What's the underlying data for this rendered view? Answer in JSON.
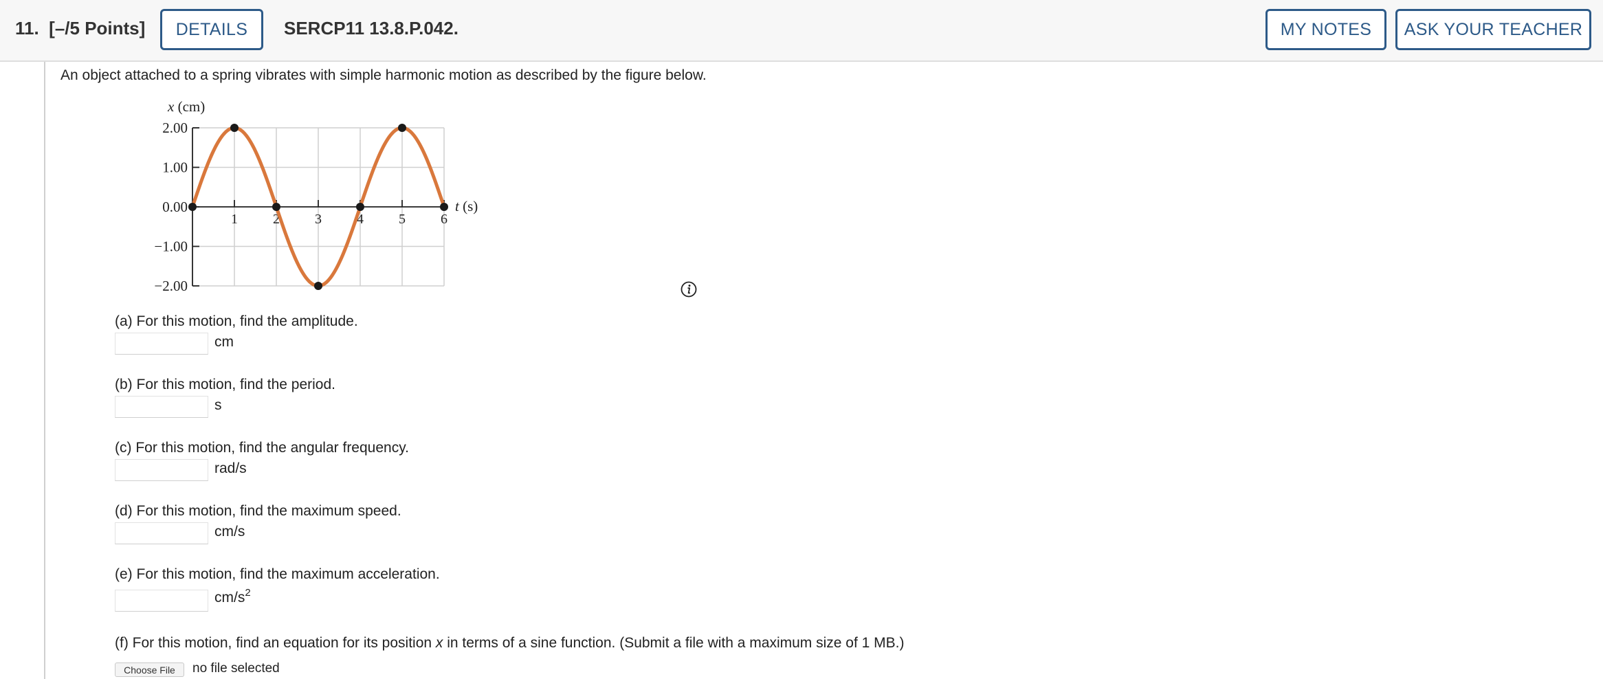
{
  "header": {
    "question_number": "11.",
    "points": "[–/5 Points]",
    "details_label": "DETAILS",
    "problem_code": "SERCP11 13.8.P.042.",
    "my_notes_label": "MY NOTES",
    "ask_teacher_label": "ASK YOUR TEACHER"
  },
  "intro": "An object attached to a spring vibrates with simple harmonic motion as described by the figure below.",
  "figure": {
    "y_axis_label": "x (cm)",
    "x_axis_label": "t (s)",
    "y_ticks": [
      "2.00",
      "1.00",
      "0.00",
      "−1.00",
      "−2.00"
    ],
    "x_ticks": [
      "1",
      "2",
      "3",
      "4",
      "5",
      "6"
    ],
    "curve_color": "#d9783c"
  },
  "chart_data": {
    "type": "line",
    "xlabel": "t (s)",
    "ylabel": "x (cm)",
    "xlim": [
      0,
      6
    ],
    "ylim": [
      -2,
      2
    ],
    "grid": true,
    "series": [
      {
        "x": [
          0,
          1,
          2,
          3,
          4,
          5,
          6
        ],
        "values": [
          0.0,
          2.0,
          0.0,
          -2.0,
          0.0,
          2.0,
          0.0
        ]
      }
    ],
    "marked_points": [
      [
        0,
        0
      ],
      [
        1,
        2
      ],
      [
        2,
        0
      ],
      [
        3,
        -2
      ],
      [
        4,
        0
      ],
      [
        5,
        2
      ],
      [
        6,
        0
      ]
    ]
  },
  "info_icon": "info-icon",
  "parts": {
    "a": {
      "question": "(a) For this motion, find the amplitude.",
      "unit": "cm"
    },
    "b": {
      "question": "(b) For this motion, find the period.",
      "unit": "s"
    },
    "c": {
      "question": "(c) For this motion, find the angular frequency.",
      "unit": "rad/s"
    },
    "d": {
      "question": "(d) For this motion, find the maximum speed.",
      "unit": "cm/s"
    },
    "e": {
      "question": "(e) For this motion, find the maximum acceleration.",
      "unit_base": "cm/s",
      "unit_exp": "2"
    },
    "f": {
      "question_pre": "(f) For this motion, find an equation for its position ",
      "question_var": "x",
      "question_post": " in terms of a sine function. (Submit a file with a maximum size of 1 MB.)",
      "choose_file_label": "Choose File",
      "file_status": "no file selected"
    }
  }
}
